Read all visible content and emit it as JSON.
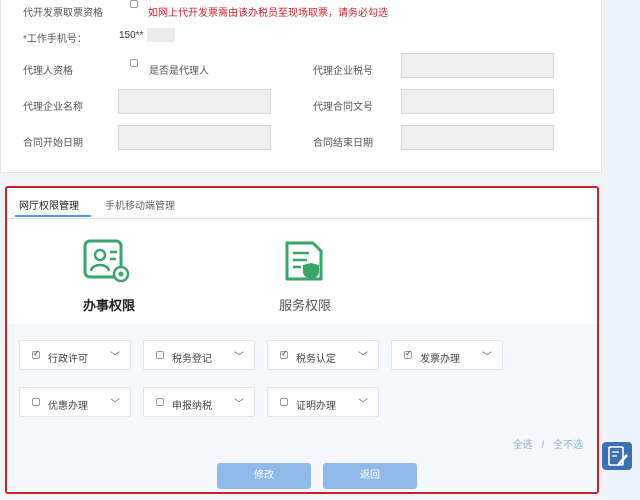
{
  "form": {
    "invoice_qualification_label": "代开发票取票资格",
    "invoice_warning": "如网上代开发票需由该办税员至现场取票，请务必勾选",
    "work_phone_label": "*工作手机号：",
    "work_phone_value": "150**",
    "agent_qualification_label": "代理人资格",
    "is_agent_label": "是否是代理人",
    "agent_tax_number_label": "代理企业税号",
    "agent_company_name_label": "代理企业名称",
    "agent_contract_number_label": "代理合同文号",
    "contract_start_label": "合同开始日期",
    "contract_end_label": "合同结束日期"
  },
  "permissions": {
    "tabs": [
      "网厅权限管理",
      "手机移动端管理"
    ],
    "business_permission_label": "办事权限",
    "service_permission_label": "服务权限",
    "items": [
      {
        "label": "行政许可",
        "checked": true
      },
      {
        "label": "税务登记",
        "checked": false
      },
      {
        "label": "税务认定",
        "checked": true
      },
      {
        "label": "发票办理",
        "checked": true
      },
      {
        "label": "优惠办理",
        "checked": false
      },
      {
        "label": "申报纳税",
        "checked": false
      },
      {
        "label": "证明办理",
        "checked": false
      }
    ],
    "select_all": "全选",
    "separator": "/",
    "deselect_all": "全不选",
    "modify_button": "修改",
    "back_button": "返回"
  },
  "colors": {
    "highlight_border": "#cd2026",
    "warning_text": "#d2232a",
    "tab_active": "#4c9be8",
    "icon_green": "#3aa56a",
    "button_blue": "#8fb9e8"
  }
}
